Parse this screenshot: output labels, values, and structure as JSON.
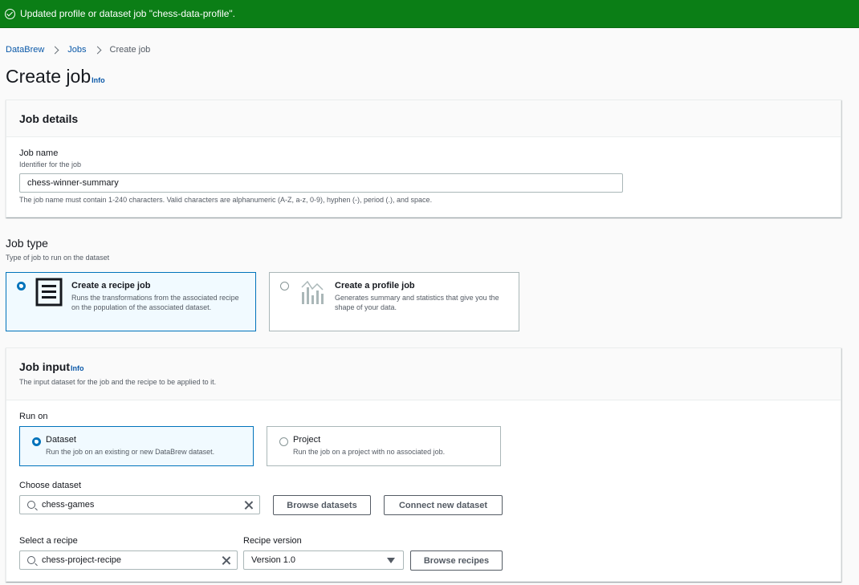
{
  "flash": {
    "message": "Updated profile or dataset job \"chess-data-profile\"."
  },
  "breadcrumb": {
    "items": [
      "DataBrew",
      "Jobs"
    ],
    "current": "Create job"
  },
  "page": {
    "title": "Create job",
    "info": "Info"
  },
  "job_details": {
    "title": "Job details",
    "name_label": "Job name",
    "name_desc": "Identifier for the job",
    "name_value": "chess-winner-summary",
    "name_hint": "The job name must contain 1-240 characters. Valid characters are alphanumeric (A-Z, a-z, 0-9), hyphen (-), period (.), and space."
  },
  "job_type": {
    "title": "Job type",
    "desc": "Type of job to run on the dataset",
    "options": [
      {
        "title": "Create a recipe job",
        "desc": "Runs the transformations from the associated recipe on the population of the associated dataset.",
        "selected": true
      },
      {
        "title": "Create a profile job",
        "desc": "Generates summary and statistics that give you the shape of your data.",
        "selected": false
      }
    ]
  },
  "job_input": {
    "title": "Job input",
    "info": "Info",
    "desc": "The input dataset for the job and the recipe to be applied to it.",
    "run_on_label": "Run on",
    "run_on_options": [
      {
        "title": "Dataset",
        "desc": "Run the job on an existing or new DataBrew dataset.",
        "selected": true
      },
      {
        "title": "Project",
        "desc": "Run the job on a project with no associated job.",
        "selected": false
      }
    ],
    "dataset_label": "Choose dataset",
    "dataset_value": "chess-games",
    "browse_datasets": "Browse datasets",
    "connect_dataset": "Connect new dataset",
    "recipe_label": "Select a recipe",
    "recipe_value": "chess-project-recipe",
    "version_label": "Recipe version",
    "version_value": "Version 1.0",
    "browse_recipes": "Browse recipes"
  }
}
